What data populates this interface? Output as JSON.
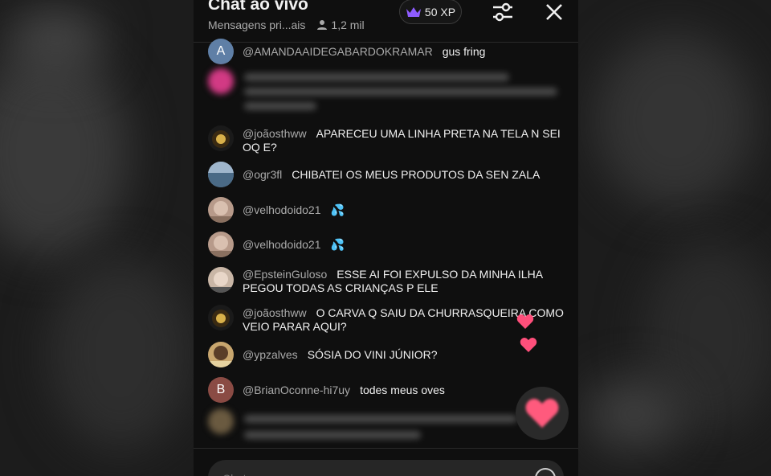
{
  "header": {
    "title": "Chat ao vivo",
    "dropdown_label": "Mensagens pri...ais",
    "viewer_count": "1,2 mil",
    "xp_label": "50 XP",
    "colors": {
      "crown": "#8e5cff"
    }
  },
  "messages": [
    {
      "author": "@AMANDAAIDEGABARDOKRAMAR",
      "text": "gus fring",
      "avatar_letter": "A",
      "avatar_color": "#5f7fa6"
    },
    {
      "author": "",
      "text": "",
      "blurred": true,
      "avatar_color": "#d23a84"
    },
    {
      "author": "@joãosthww",
      "text": "APARECEU UMA LINHA PRETA NA TELA N SEI OQ E?",
      "avatar_color": "#3a2a12"
    },
    {
      "author": "@ogr3fl",
      "text": "CHIBATEI OS MEUS PRODUTOS DA SEN ZALA",
      "avatar_color": "#6d8aa8"
    },
    {
      "author": "@velhodoido21",
      "text": "💦",
      "avatar_color": "#b79a8a"
    },
    {
      "author": "@velhodoido21",
      "text": "💦",
      "avatar_color": "#b79a8a"
    },
    {
      "author": "@EpsteinGuloso",
      "text": "ESSE AI FOI EXPULSO DA MINHA ILHA PEGOU TODAS AS CRIANÇAS P ELE",
      "avatar_color": "#c9b6a6"
    },
    {
      "author": "@joãosthww",
      "text": "O CARVA Q SAIU DA CHURRASQUEIRA COMO VEIO PARAR AQUI?",
      "avatar_color": "#3a2a12"
    },
    {
      "author": "@ypzalves",
      "text": "SÓSIA DO VINI JÚNIOR?",
      "avatar_color": "#c8a66e"
    },
    {
      "author": "@BrianOconne-hi7uy",
      "text": "todes meus oves",
      "avatar_letter": "B",
      "avatar_color": "#8a4b44"
    },
    {
      "author": "",
      "text": "",
      "blurred": true,
      "avatar_color": "#6a5a40"
    }
  ],
  "input": {
    "placeholder": "Chat..."
  },
  "icons": {
    "crown": "crown-icon",
    "person": "person-icon",
    "settings": "sliders-icon",
    "close": "close-icon",
    "heart": "heart-icon",
    "emoji": "emoji-icon"
  }
}
